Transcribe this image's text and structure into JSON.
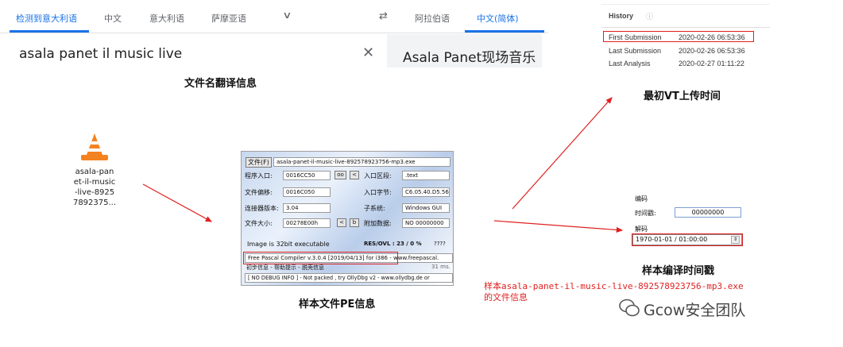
{
  "translate": {
    "source_tabs": [
      "检测到意大利语",
      "中文",
      "意大利语",
      "萨摩亚语"
    ],
    "target_tabs": [
      "阿拉伯语",
      "中文(简体)"
    ],
    "source_text": "asala panet il music live",
    "target_text": "Asala Panet现场音乐",
    "swap_icon": "⇄",
    "clear_icon": "✕",
    "caption": "文件名翻译信息"
  },
  "file": {
    "name_lines": [
      "asala-pan",
      "et-il-music",
      "-live-8925",
      "7892375..."
    ]
  },
  "pe": {
    "file_button": "文件(F)",
    "file_path": "asala-panet-il-music-live-892578923756-mp3.exe",
    "entry_point_label": "程序入口:",
    "entry_point": "0016CC50",
    "entry_section_label": "入口区段:",
    "entry_section": ".text",
    "file_offset_label": "文件偏移:",
    "file_offset": "0016C050",
    "entry_bytes_label": "入口字节:",
    "entry_bytes": "C6.05.40.D5.56",
    "linker_label": "连接器版本:",
    "linker": "3.04",
    "subsystem_label": "子系统:",
    "subsystem": "Windows GUI",
    "size_label": "文件大小:",
    "size": "00278E00h",
    "overlay_label": "附加数据:",
    "overlay": "NO  00000000",
    "oo_btn": "oo",
    "lt_btn": "<",
    "b_btn": "b",
    "bits_text": "Image is 32bit executable",
    "res_text": "RES/OVL : 23 / 0 %",
    "res_q": "????",
    "compiler": "Free Pascal Compiler v.3.0.4 [2019/04/13] for i386",
    "compiler_url": "- www.freepascal.",
    "hint": "初步信息 - 帮助提示 - 脱壳信息",
    "hint_ms": "31 ms.",
    "debug": "[ NO DEBUG INFO ] - Not packed , try OllyDbg v2 - www.ollydbg.de or",
    "caption": "样本文件PE信息"
  },
  "vt": {
    "title": "History",
    "info_icon": "ⓘ",
    "rows": [
      {
        "label": "First Submission",
        "value": "2020-02-26 06:53:36"
      },
      {
        "label": "Last Submission",
        "value": "2020-02-26 06:53:36"
      },
      {
        "label": "Last Analysis",
        "value": "2020-02-27 01:11:22"
      }
    ],
    "caption": "最初VT上传时间"
  },
  "timestamp": {
    "encode_label": "编码",
    "timestamp_label": "时间戳:",
    "timestamp_value": "00000000",
    "decode_label": "解码",
    "decoded": "1970-01-01 / 01:00:00",
    "caption": "样本编译时间戳"
  },
  "note": {
    "line1": "样本asala-panet-il-music-live-892578923756-mp3.exe",
    "line2": "的文件信息"
  },
  "watermark": "Gcow安全团队",
  "colors": {
    "accent": "#1a73e8",
    "annotation_red": "#e02020"
  }
}
